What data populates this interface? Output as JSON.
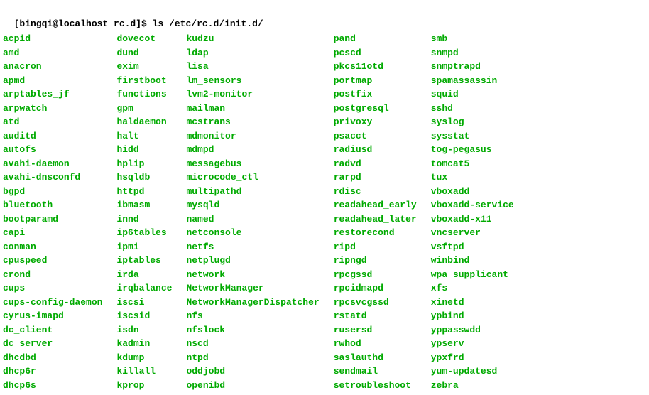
{
  "prompt": {
    "user_host": "[bingqi@localhost rc.d]$",
    "command": "ls /etc/rc.d/init.d/"
  },
  "columns": [
    {
      "items": [
        "acpid",
        "amd",
        "anacron",
        "apmd",
        "arptables_jf",
        "arpwatch",
        "atd",
        "auditd",
        "autofs",
        "avahi-daemon",
        "avahi-dnsconfd",
        "bgpd",
        "bluetooth",
        "bootparamd",
        "capi",
        "conman",
        "cpuspeed",
        "crond",
        "cups",
        "cups-config-daemon",
        "cyrus-imapd",
        "dc_client",
        "dc_server",
        "dhcdbd",
        "dhcp6r",
        "dhcp6s"
      ]
    },
    {
      "items": [
        "dovecot",
        "dund",
        "exim",
        "firstboot",
        "functions",
        "gpm",
        "haldaemon",
        "halt",
        "hidd",
        "hplip",
        "hsqldb",
        "httpd",
        "ibmasm",
        "innd",
        "ip6tables",
        "ipmi",
        "iptables",
        "irda",
        "irqbalance",
        "iscsi",
        "iscsid",
        "isdn",
        "kadmin",
        "kdump",
        "killall",
        "kprop"
      ]
    },
    {
      "items": [
        "kudzu",
        "ldap",
        "lisa",
        "lm_sensors",
        "lvm2-monitor",
        "mailman",
        "mcstrans",
        "mdmonitor",
        "mdmpd",
        "messagebus",
        "microcode_ctl",
        "multipathd",
        "mysqld",
        "named",
        "netconsole",
        "netfs",
        "netplugd",
        "network",
        "NetworkManager",
        "NetworkManagerDispatcher",
        "nfs",
        "nfslock",
        "nscd",
        "ntpd",
        "oddjobd",
        "openibd"
      ]
    },
    {
      "items": [
        "pand",
        "pcscd",
        "pkcs11otd",
        "portmap",
        "postfix",
        "postgresql",
        "privoxy",
        "psacct",
        "radiusd",
        "radvd",
        "rarpd",
        "rdisc",
        "readahead_early",
        "readahead_later",
        "restorecond",
        "ripd",
        "ripngd",
        "rpcgssd",
        "rpcidmapd",
        "rpcsvcgssd",
        "rstatd",
        "rusersd",
        "rwhod",
        "saslauthd",
        "sendmail",
        "setroubleshoot"
      ]
    },
    {
      "items": [
        "smb",
        "snmpd",
        "snmptrapd",
        "spamassassin",
        "squid",
        "sshd",
        "syslog",
        "sysstat",
        "tog-pegasus",
        "tomcat5",
        "tux",
        "vboxadd",
        "vboxadd-service",
        "vboxadd-x11",
        "vncserver",
        "vsftpd",
        "winbind",
        "wpa_supplicant",
        "xfs",
        "xinetd",
        "ypbind",
        "yppasswdd",
        "ypserv",
        "ypxfrd",
        "yum-updatesd",
        "zebra"
      ]
    }
  ]
}
